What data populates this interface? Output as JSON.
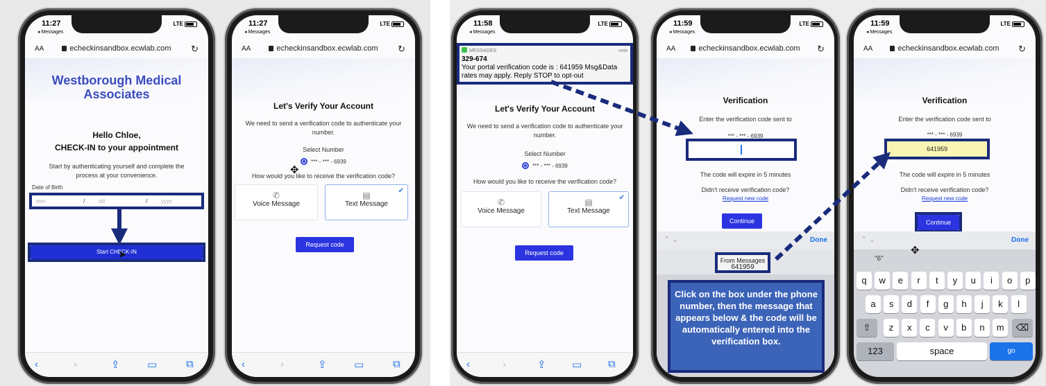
{
  "screens": {
    "s1": {
      "time": "11:27",
      "back": "◂ Messages",
      "signal": "LTE",
      "url": "echeckinsandbox.ecwlab.com",
      "aa": "AA",
      "practice_name": "Westborough Medical Associates",
      "greeting": "Hello Chloe,",
      "subtitle": "CHECK-IN to your appointment",
      "intro": "Start by authenticating yourself and complete the process at your convenience.",
      "dob_label": "Date of Birth",
      "dob_placeholders": {
        "month": "mm",
        "day": "dd",
        "year": "yyyy"
      },
      "start_button": "Start CHECK-IN"
    },
    "s2": {
      "time": "11:27",
      "back": "◂ Messages",
      "signal": "LTE",
      "url": "echeckinsandbox.ecwlab.com",
      "aa": "AA",
      "heading": "Let's Verify Your Account",
      "description": "We need to send a verification code to authenticate your number.",
      "select_number": "Select Number",
      "phone": "*** - *** - 6939",
      "question": "How would you like to receive the verification code?",
      "voice": "Voice Message",
      "text": "Text Message",
      "request": "Request code"
    },
    "s3": {
      "time": "11:58",
      "back": "◂ Messages",
      "signal": "LTE",
      "notif_app": "MESSAGES",
      "notif_time": "now",
      "notif_sender": "329-674",
      "notif_body": "Your portal verification code is : 641959 Msg&Data rates may apply. Reply STOP to opt-out",
      "heading": "Let's Verify Your Account",
      "description": "We need to send a verification code to authenticate your number.",
      "select_number": "Select Number",
      "phone": "*** - *** - 6939",
      "question": "How would you like to receive the verification code?",
      "voice": "Voice Message",
      "text": "Text Message",
      "request": "Request code"
    },
    "s4": {
      "time": "11:59",
      "back": "◂ Messages",
      "signal": "LTE",
      "url": "echeckinsandbox.ecwlab.com",
      "aa": "AA",
      "heading": "Verification",
      "prompt": "Enter the verification code sent to",
      "phone": "*** - *** - 6939",
      "expire": "The code will expire in 5 minutes",
      "didnt": "Didn't receive verification code?",
      "request_new": "Request new code",
      "continue": "Continue",
      "done": "Done",
      "suggest_title": "From Messages",
      "suggest_code": "641959"
    },
    "s5": {
      "time": "11:59",
      "back": "◂ Messages",
      "signal": "LTE",
      "url": "echeckinsandbox.ecwlab.com",
      "aa": "AA",
      "heading": "Verification",
      "prompt": "Enter the verification code sent to",
      "phone": "*** - *** - 6939",
      "code_value": "641959",
      "expire": "The code will expire in 5 minutes",
      "didnt": "Didn't receive verification code?",
      "request_new": "Request new code",
      "continue": "Continue",
      "done": "Done",
      "suggest": "\"6\"",
      "row1": [
        "q",
        "w",
        "e",
        "r",
        "t",
        "y",
        "u",
        "i",
        "o",
        "p"
      ],
      "row2": [
        "a",
        "s",
        "d",
        "f",
        "g",
        "h",
        "j",
        "k",
        "l"
      ],
      "row3": [
        "z",
        "x",
        "c",
        "v",
        "b",
        "n",
        "m"
      ],
      "num_key": "123",
      "space_key": "space",
      "go_key": "go"
    }
  },
  "callout": "Click on the box under the phone number, then the message that appears below & the code will be automatically entered into the verification box.",
  "colors": {
    "annotation": "#1a2b7c",
    "callout_bg": "#3b63b8",
    "primary_button": "#2b34e0",
    "practice_title": "#3b4bbf"
  }
}
